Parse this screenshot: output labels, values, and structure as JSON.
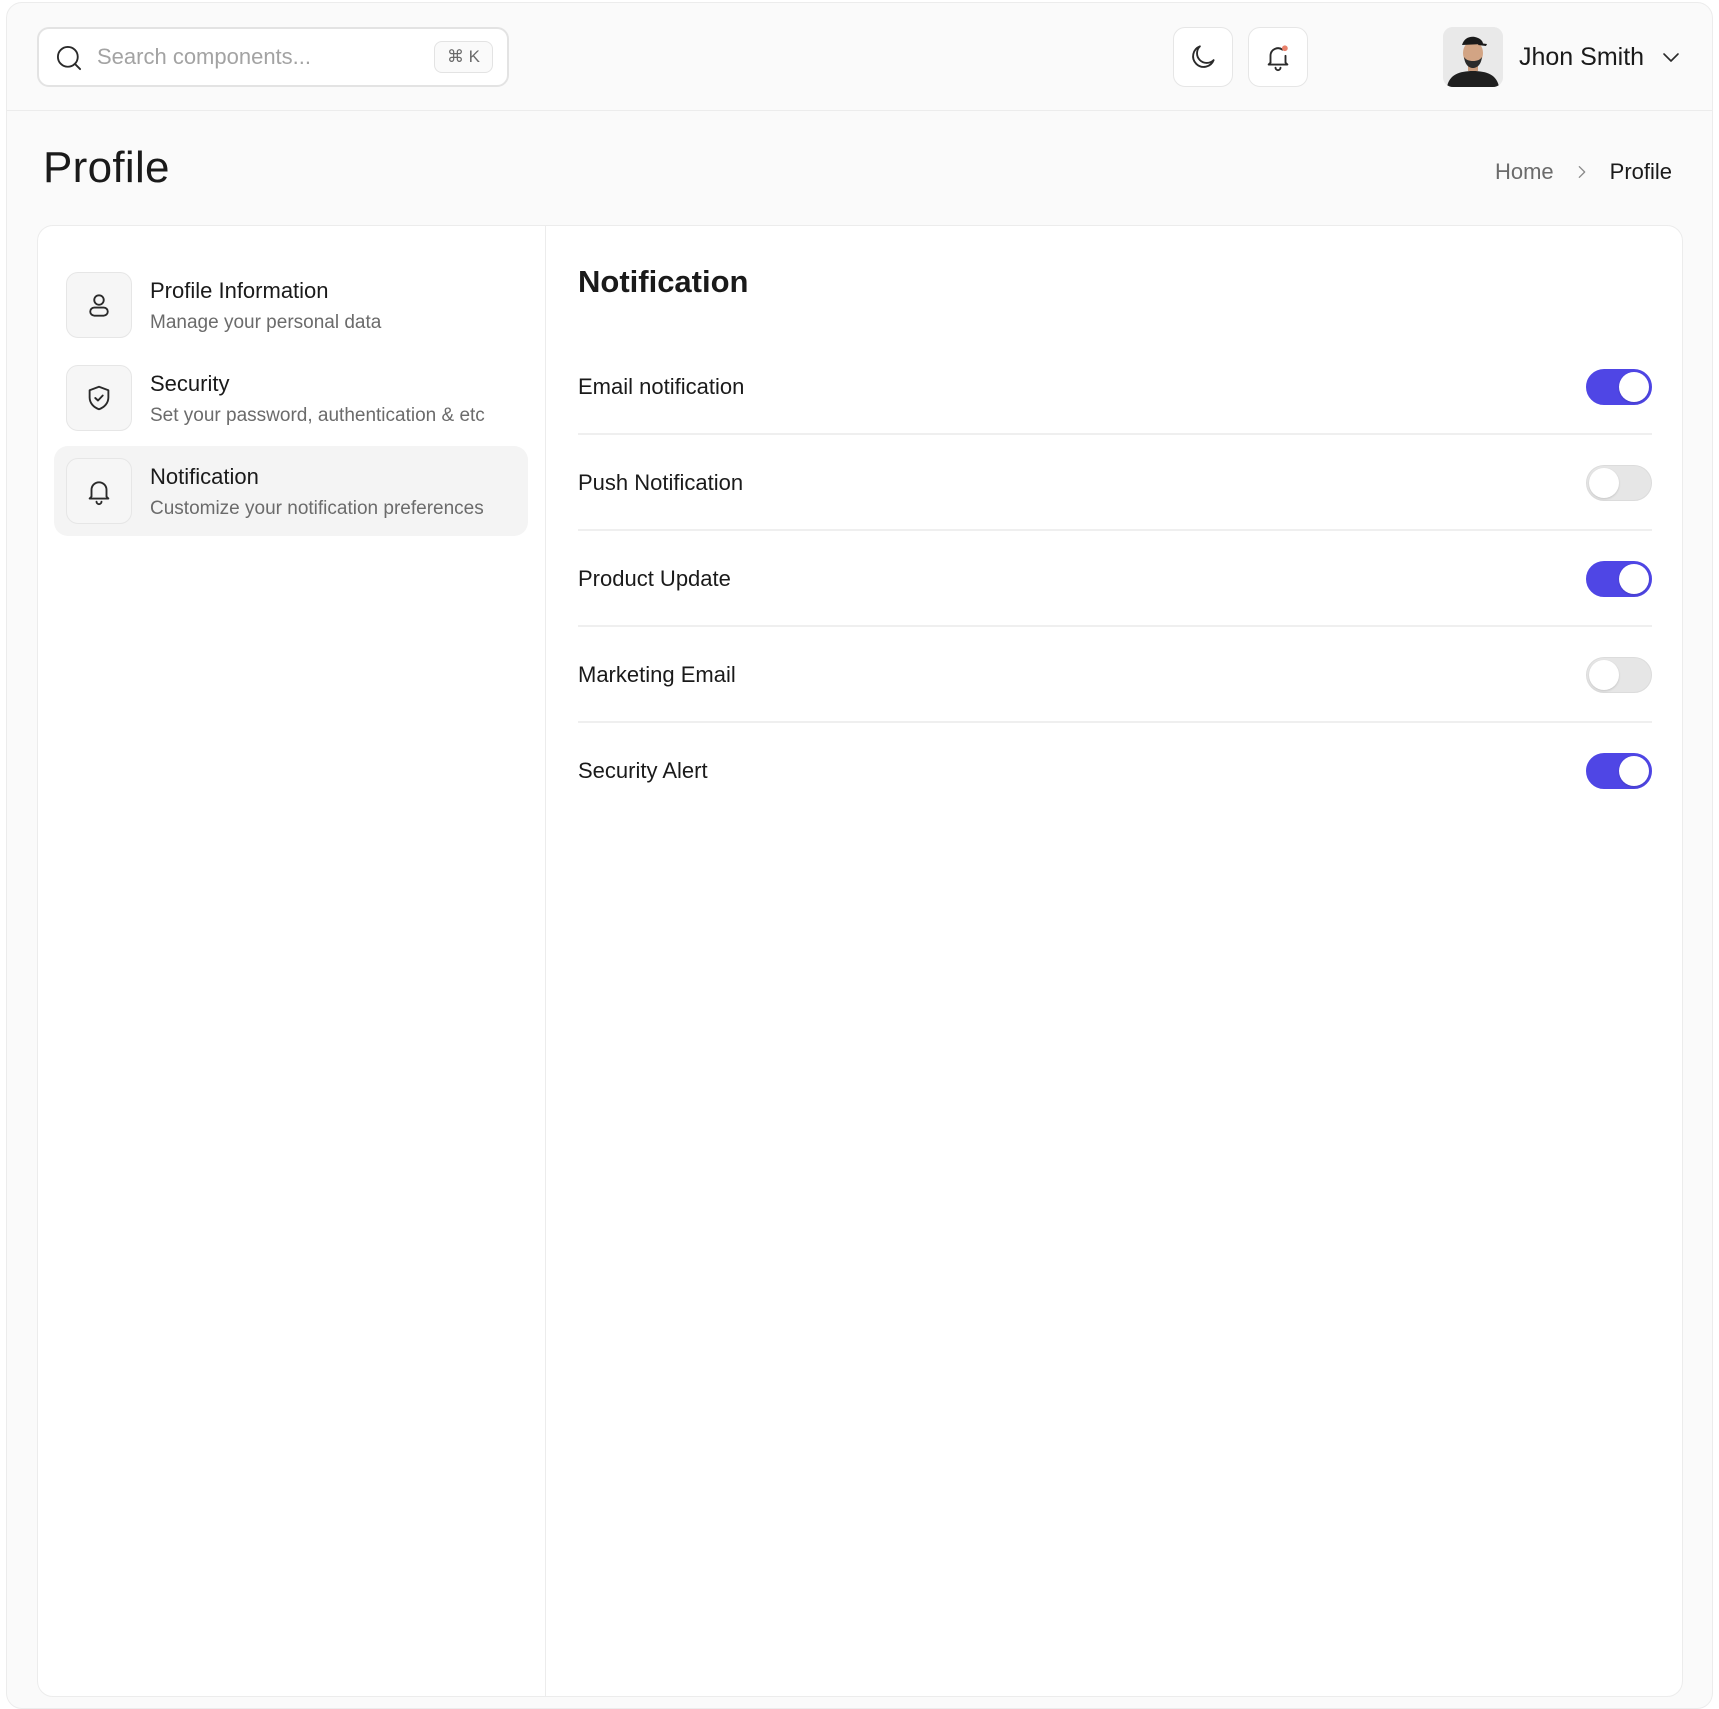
{
  "search": {
    "placeholder": "Search components...",
    "shortcut": "⌘ K"
  },
  "header": {
    "theme_icon": "moon-icon",
    "notification_icon": "bell-icon",
    "user_name": "Jhon Smith"
  },
  "page": {
    "title": "Profile"
  },
  "breadcrumb": {
    "home": "Home",
    "current": "Profile"
  },
  "sidebar": {
    "items": [
      {
        "title": "Profile Information",
        "subtitle": "Manage your personal data",
        "icon": "user-icon",
        "active": false
      },
      {
        "title": "Security",
        "subtitle": "Set your password, authentication & etc",
        "icon": "shield-check-icon",
        "active": false
      },
      {
        "title": "Notification",
        "subtitle": "Customize your notification preferences",
        "icon": "bell-icon",
        "active": true
      }
    ]
  },
  "notifications": {
    "title": "Notification",
    "settings": [
      {
        "label": "Email notification",
        "enabled": true
      },
      {
        "label": "Push Notification",
        "enabled": false
      },
      {
        "label": "Product Update",
        "enabled": true
      },
      {
        "label": "Marketing Email",
        "enabled": false
      },
      {
        "label": "Security Alert",
        "enabled": true
      }
    ]
  },
  "colors": {
    "accent": "#4f46e5",
    "notification_dot": "#e8806a"
  }
}
